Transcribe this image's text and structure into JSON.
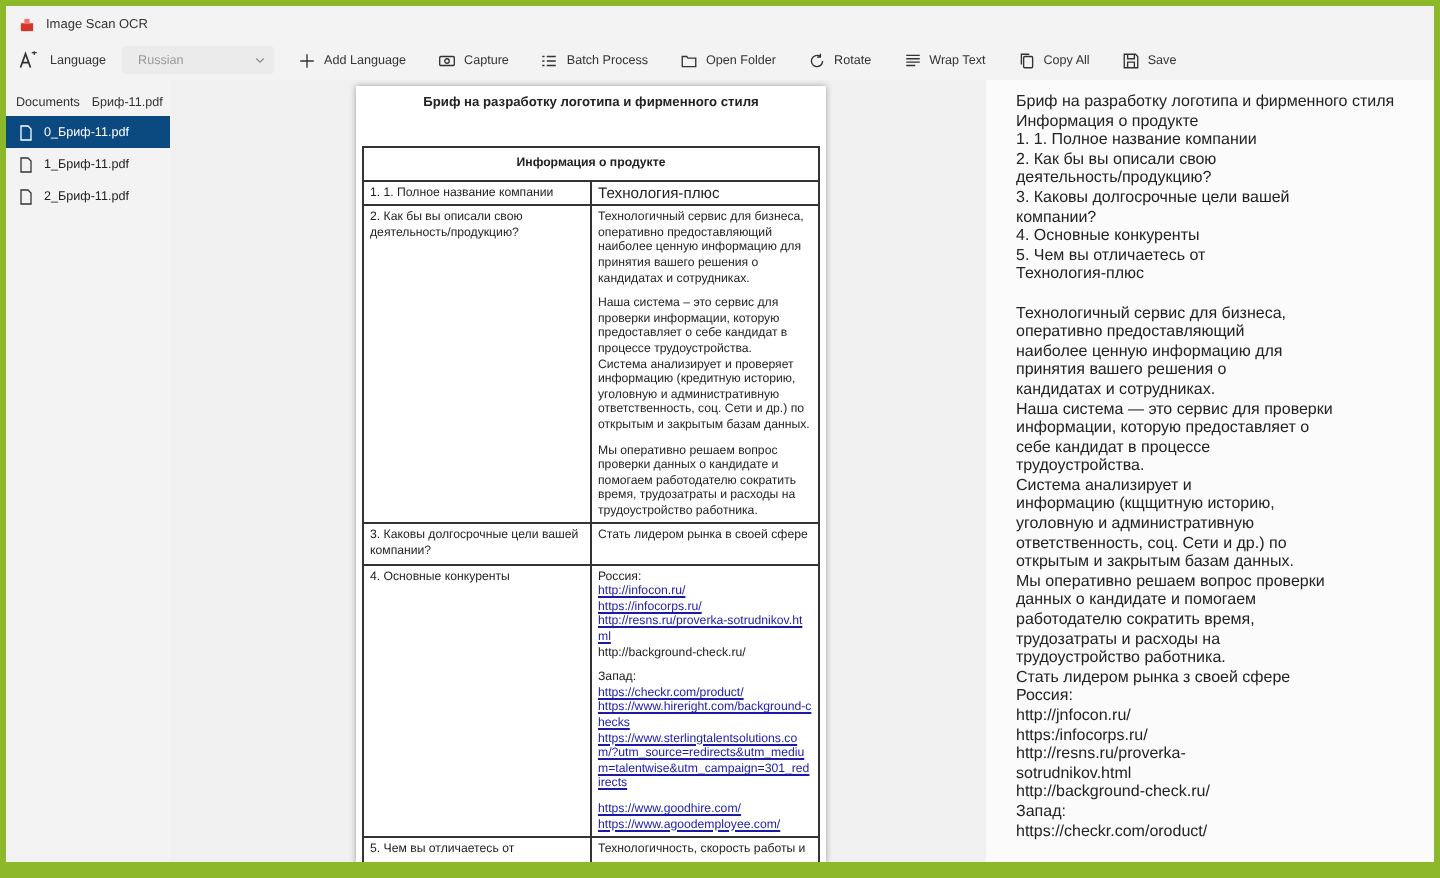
{
  "window": {
    "title": "Image Scan OCR"
  },
  "toolbar": {
    "language_label": "Language",
    "language": {
      "value": "Russian",
      "disabled": true
    },
    "buttons": [
      {
        "kind": "add",
        "label": "Add Language"
      },
      {
        "kind": "camera",
        "label": "Capture"
      },
      {
        "kind": "list",
        "label": "Batch Process"
      },
      {
        "kind": "folder",
        "label": "Open Folder"
      },
      {
        "kind": "rotate",
        "label": "Rotate"
      },
      {
        "kind": "wrap",
        "label": "Wrap Text"
      },
      {
        "kind": "copy",
        "label": "Copy All"
      },
      {
        "kind": "save",
        "label": "Save"
      }
    ]
  },
  "sidebar": {
    "breadcrumb": [
      "Documents",
      "Бриф-11.pdf"
    ],
    "items": [
      {
        "label": "0_Бриф-11.pdf",
        "selected": true
      },
      {
        "label": "1_Бриф-11.pdf",
        "selected": false
      },
      {
        "label": "2_Бриф-11.pdf",
        "selected": false
      }
    ]
  },
  "document": {
    "title": "Бриф на разработку логотипа и фирменного стиля",
    "section": "Информация о продукте",
    "rows": [
      {
        "question": "1.  1. Полное название компании",
        "answer": [
          [
            {
              "kind": "large",
              "text": "Технология-плюс"
            }
          ]
        ]
      },
      {
        "question": "2. Как бы вы описали свою деятельность/продукцию?",
        "answer": [
          [
            {
              "kind": "text",
              "text": "Технологичный сервис для бизнеса, оперативно предоставляющий наиболее ценную информацию для принятия вашего решения о кандидатах и сотрудниках."
            }
          ],
          [
            {
              "kind": "text",
              "text": "Наша система – это сервис для проверки информации, которую предоставляет о себе кандидат в процессе трудоустройства."
            },
            {
              "kind": "text",
              "text": "Система анализирует и проверяет информацию (кредитную историю, уголовную и административную ответственность, соц. Сети и др.)  по открытым и закрытым базам данных."
            }
          ],
          [
            {
              "kind": "text",
              "text": "Мы оперативно решаем вопрос проверки данных о кандидате и помогаем работодателю сократить время, трудозатраты и расходы на трудоустройство работника."
            }
          ]
        ]
      },
      {
        "question": "3. Каковы долгосрочные цели вашей компании?",
        "answer": [
          [
            {
              "kind": "text",
              "text": "Стать лидером рынка в своей сфере"
            }
          ]
        ]
      },
      {
        "question": "4. Основные конкуренты",
        "answer": [
          [
            {
              "kind": "text",
              "text": "Россия:"
            },
            {
              "kind": "link",
              "text": "http://infocon.ru/"
            },
            {
              "kind": "link",
              "text": "https://infocorps.ru/"
            },
            {
              "kind": "link",
              "text": "http://resns.ru/proverka-sotrudnikov.html"
            },
            {
              "kind": "text",
              "text": "http://background-check.ru/"
            }
          ],
          [
            {
              "kind": "text",
              "text": "Запад:"
            },
            {
              "kind": "link",
              "text": "https://checkr.com/product/"
            },
            {
              "kind": "link",
              "text": "https://www.hireright.com/background-checks"
            },
            {
              "kind": "link",
              "text": "https://www.sterlingtalentsolutions.com/?utm_source=redirects&utm_medium=talentwise&utm_campaign=301_redirects"
            }
          ],
          [
            {
              "kind": "link",
              "text": "https://www.goodhire.com/"
            },
            {
              "kind": "link",
              "text": "https://www.agoodemployee.com/"
            }
          ]
        ]
      },
      {
        "question": "5. Чем вы отличаетесь от",
        "answer": [
          [
            {
              "kind": "text",
              "text": "Технологичность, скорость работы и"
            }
          ]
        ]
      }
    ]
  },
  "ocr_text": {
    "paragraphs": [
      [
        "Бриф на разработку логотипа и фирменного стиля",
        "Информация о продукте",
        "1. 1. Полное название компании",
        "2. Как бы вы описали свою",
        "деятельность/продукцию?",
        "3. Каковы долгосрочные цели вашей",
        "компании?",
        "4. Основные конкуренты",
        "5. Чем вы отличаетесь от",
        "Технология-плюс"
      ],
      [
        "Технологичный сервис для бизнеса,",
        "оперативно предоставляющий",
        "наиболее ценную информацию для",
        "принятия вашего решения о",
        "кандидатах и сотрудниках.",
        "Наша система — это сервис для проверки",
        "информации, которую предоставляет о",
        "себе кандидат в процессе",
        "трудоустройства.",
        "Система анализирует и",
        "информацию (кщщитную историю,",
        "уголовную и административную",
        "ответственность, соц. Сети и др.) по",
        "открытым и закрытым базам данных.",
        "Мы оперативно решаем вопрос проверки",
        "данных о кандидате и помогаем",
        "работодателю сократить время,",
        "трудозатраты и расходы на",
        "трудоустройство работника.",
        "Стать лидером рынка з своей сфере",
        "Россия:",
        "http://jnfocon.ru/",
        "https:/infocorps.ru/",
        "http://resns.ru/proverka-",
        "sotrudnikov.html",
        "http://background-check.ru/",
        "Запад:",
        "https://checkr.com/oroduct/"
      ]
    ]
  }
}
